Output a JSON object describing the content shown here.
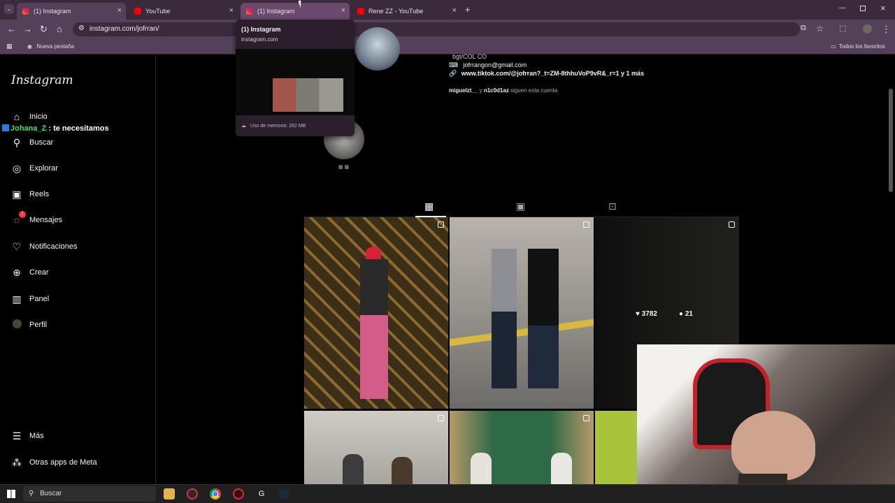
{
  "browser": {
    "tabs": [
      {
        "title": "(1) Instagram",
        "kind": "instagram"
      },
      {
        "title": "YouTube",
        "kind": "youtube"
      },
      {
        "title": "(1) Instagram",
        "kind": "instagram"
      },
      {
        "title": "Rene ZZ - YouTube",
        "kind": "youtube"
      }
    ],
    "url": "instagram.com/jofrran/",
    "bookmark_new_tab": "Nueva pestaña",
    "bookmark_favorites": "Todos los favoritos"
  },
  "tooltip": {
    "title": "(1) Instagram",
    "domain": "instagram.com",
    "memory": "Uso de memoria: 262 MB"
  },
  "sidebar": {
    "logo": "Instagram",
    "items": [
      {
        "label": "Inicio",
        "icon": "home-icon"
      },
      {
        "label": "Buscar",
        "icon": "search-icon"
      },
      {
        "label": "Explorar",
        "icon": "compass-icon"
      },
      {
        "label": "Reels",
        "icon": "reels-icon"
      },
      {
        "label": "Mensajes",
        "icon": "messenger-icon",
        "badge": "1"
      },
      {
        "label": "Notificaciones",
        "icon": "heart-icon"
      },
      {
        "label": "Crear",
        "icon": "plus-icon"
      },
      {
        "label": "Panel",
        "icon": "chart-icon"
      },
      {
        "label": "Perfil",
        "icon": "avatar-icon"
      }
    ],
    "more": "Más",
    "meta_apps": "Otras apps de Meta"
  },
  "chat_overlay": {
    "user": "Johana_Z",
    "message": ": te necesitamos"
  },
  "profile": {
    "bio_line1": "bgt/COL CO",
    "email": "jofrrangon@gmail.com",
    "link": "www.tiktok.com/@jofrran?_t=ZM-8thhuVoP9vR&_r=1 y 1 más",
    "followed_by_1": "miguelzt__",
    "followed_by_and": "y",
    "followed_by_2": "n1c0d1az",
    "followed_by_suffix": "siguen esta cuenta"
  },
  "post_stats": {
    "likes": "3782",
    "comments": "21"
  },
  "taskbar": {
    "search": "Buscar"
  }
}
